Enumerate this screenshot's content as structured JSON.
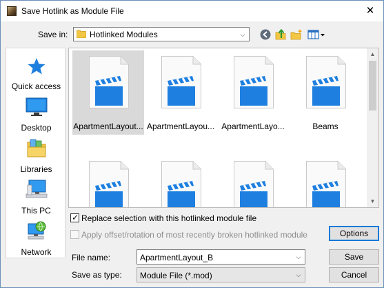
{
  "window": {
    "title": "Save Hotlink as Module File"
  },
  "toolbar": {
    "save_in_label": "Save in:",
    "save_in_value": "Hotlinked Modules"
  },
  "places": [
    {
      "label": "Quick access"
    },
    {
      "label": "Desktop"
    },
    {
      "label": "Libraries"
    },
    {
      "label": "This PC"
    },
    {
      "label": "Network"
    }
  ],
  "files": [
    {
      "name": "ApartmentLayout...",
      "selected": true
    },
    {
      "name": "ApartmentLayou..."
    },
    {
      "name": "ApartmentLayo..."
    },
    {
      "name": "Beams"
    },
    {
      "name": ""
    },
    {
      "name": ""
    },
    {
      "name": ""
    },
    {
      "name": ""
    }
  ],
  "options": {
    "replace_label": "Replace selection with this hotlinked module file",
    "replace_checked": true,
    "apply_label": "Apply offset/rotation of most recently broken hotlinked module",
    "apply_checked": false
  },
  "form": {
    "file_name_label": "File name:",
    "file_name_value": "ApartmentLayout_B",
    "save_type_label": "Save as type:",
    "save_type_value": "Module File (*.mod)"
  },
  "buttons": {
    "options": "Options",
    "save": "Save",
    "cancel": "Cancel"
  },
  "colors": {
    "accent": "#0078d7",
    "clapper": "#1e7fe0"
  }
}
